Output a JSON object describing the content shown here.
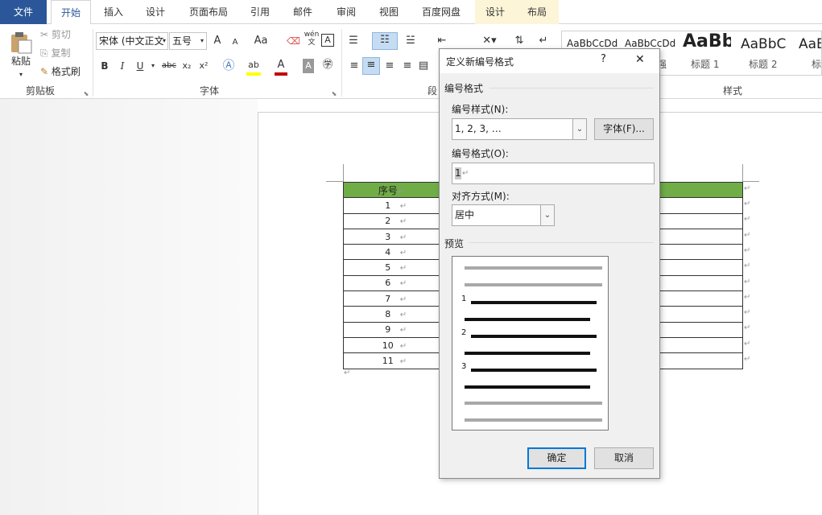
{
  "tabs": [
    "文件",
    "开始",
    "插入",
    "设计",
    "页面布局",
    "引用",
    "邮件",
    "审阅",
    "视图",
    "百度网盘",
    "设计",
    "布局"
  ],
  "clipboard": {
    "paste": "粘贴",
    "cut": "剪切",
    "copy": "复制",
    "format_painter": "格式刷",
    "group_label": "剪贴板"
  },
  "font": {
    "name": "宋体 (中文正文",
    "size": "五号",
    "group_label": "字体",
    "grow": "A",
    "shrink": "A",
    "case": "Aa",
    "bold": "B",
    "italic": "I",
    "underline": "U",
    "strike": "abc",
    "sub": "x₂",
    "sup": "x²",
    "phonetic": "wén",
    "phonetic2": "文",
    "border": "A"
  },
  "paragraph": {
    "group_label": "段"
  },
  "styles": {
    "group_label": "样式",
    "items": [
      {
        "sample": "AaBbCcDd",
        "name": ""
      },
      {
        "sample": "AaBbCcDd",
        "name": "强"
      },
      {
        "sample": "AaBb",
        "name": "标题 1"
      },
      {
        "sample": "AaBbC",
        "name": "标题 2"
      },
      {
        "sample": "AaE",
        "name": "标"
      }
    ]
  },
  "table": {
    "header": "序号",
    "rows": [
      "1",
      "2",
      "3",
      "4",
      "5",
      "6",
      "7",
      "8",
      "9",
      "10",
      "11"
    ]
  },
  "dialog": {
    "title": "定义新编号格式",
    "help": "?",
    "close": "✕",
    "section_format": "编号格式",
    "style_label": "编号样式(N):",
    "style_value": "1, 2, 3, …",
    "font_button": "字体(F)...",
    "format_label": "编号格式(O):",
    "format_value": "1",
    "align_label": "对齐方式(M):",
    "align_value": "居中",
    "section_preview": "预览",
    "preview_numbers": [
      "1",
      "2",
      "3"
    ],
    "ok": "确定",
    "cancel": "取消"
  },
  "colors": {
    "file_tab": "#2b579a",
    "header_green": "#70ad47",
    "focus_blue": "#0078d7"
  }
}
